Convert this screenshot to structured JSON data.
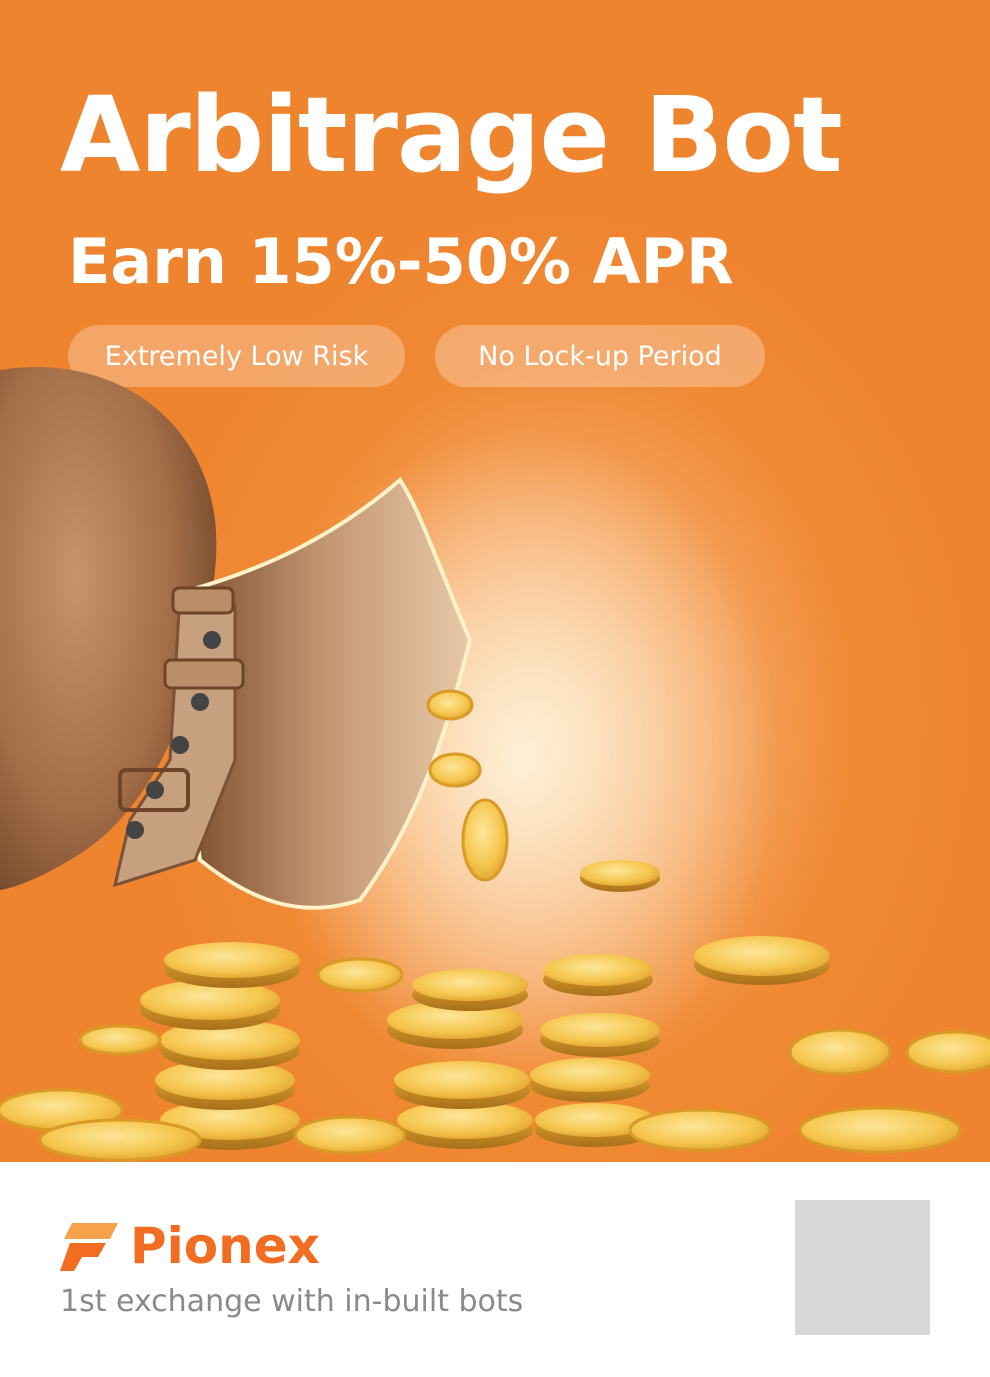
{
  "hero": {
    "title": "Arbitrage Bot",
    "subtitle": "Earn 15%-50% APR",
    "features": [
      "Extremely Low Risk",
      "No Lock-up Period"
    ]
  },
  "brand": {
    "name": "Pionex",
    "tagline": "1st exchange with in-built bots",
    "color": "#f26d21"
  },
  "colors": {
    "background": "#ef842f",
    "glow": "#f9c58f",
    "coin": "#f2c04a",
    "bag": "#b07a4f"
  },
  "icons": [
    "pionex-logo-icon",
    "money-bag-illustration",
    "gold-coins-illustration",
    "qr-code-placeholder"
  ]
}
